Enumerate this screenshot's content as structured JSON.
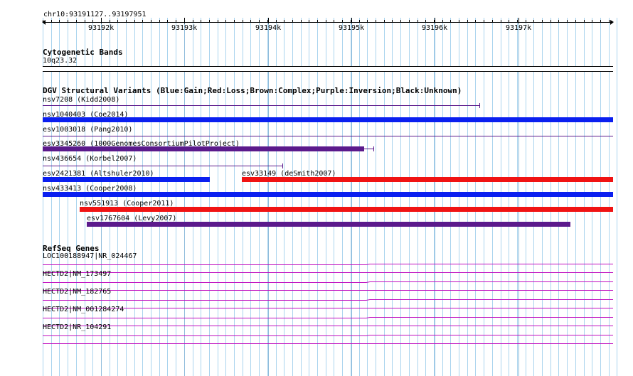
{
  "ruler": {
    "position_label": "chr10:93191127..93197951",
    "ticks": [
      "93192k",
      "93193k",
      "93194k",
      "93195k",
      "93196k",
      "93197k"
    ]
  },
  "cytogenetic": {
    "title": "Cytogenetic Bands",
    "band_label": "10q23.32"
  },
  "dgv": {
    "title": "DGV Structural Variants (Blue:Gain;Red:Loss;Brown:Complex;Purple:Inversion;Black:Unknown)",
    "colors": {
      "gain": "#0a1ff0",
      "loss": "#f01313",
      "complex": "#8b4513",
      "inversion": "#5b1a8c",
      "unknown": "#000000"
    },
    "variants": [
      {
        "id": "nsv7208",
        "label": "nsv7208 (Kidd2008)",
        "type": "inversion",
        "style": "thin"
      },
      {
        "id": "nsv1040403",
        "label": "nsv1040403 (Coe2014)",
        "type": "gain",
        "style": "thick"
      },
      {
        "id": "esv1003018",
        "label": "esv1003018 (Pang2010)",
        "type": "inversion",
        "style": "thin"
      },
      {
        "id": "esv3345260",
        "label": "esv3345260 (1000GenomesConsortiumPilotProject)",
        "type": "inversion",
        "style": "thick"
      },
      {
        "id": "nsv436654",
        "label": "nsv436654 (Korbel2007)",
        "type": "inversion",
        "style": "thin"
      },
      {
        "id": "esv2421381",
        "label": "esv2421381 (Altshuler2010)",
        "type": "gain",
        "style": "thick"
      },
      {
        "id": "esv33149",
        "label": "esv33149 (deSmith2007)",
        "type": "loss",
        "style": "thick"
      },
      {
        "id": "nsv433413",
        "label": "nsv433413 (Cooper2008)",
        "type": "gain",
        "style": "thick"
      },
      {
        "id": "nsv551913",
        "label": "nsv551913 (Cooper2011)",
        "type": "loss",
        "style": "thick"
      },
      {
        "id": "esv1767604",
        "label": "esv1767604 (Levy2007)",
        "type": "inversion",
        "style": "thick"
      }
    ]
  },
  "refseq": {
    "title": "RefSeq Genes",
    "gene_color": "#c010c0",
    "genes": [
      {
        "label": "LOC100188947|NR_024467"
      },
      {
        "label": "HECTD2|NM_173497"
      },
      {
        "label": "HECTD2|NM_182765"
      },
      {
        "label": "HECTD2|NM_001284274"
      },
      {
        "label": "HECTD2|NR_104291"
      }
    ]
  }
}
